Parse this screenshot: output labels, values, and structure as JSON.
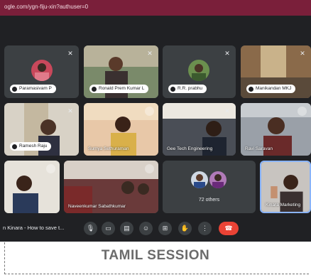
{
  "browser": {
    "url": "ogle.com/ygn-fiju-xin?authuser=0"
  },
  "participants": [
    {
      "name": "Paramasivam P"
    },
    {
      "name": "Ronald Prem Kumar L"
    },
    {
      "name": "R.R. prabhu"
    },
    {
      "name": "Manikandan MKJ"
    },
    {
      "name": "Ramesh Raju"
    },
    {
      "name": "Sumya Sethuraman"
    },
    {
      "name": "Gee Tech Engineering"
    },
    {
      "name": "Ravi Saravan"
    },
    {
      "name": ""
    },
    {
      "name": "Naveenkumar Sabathkumar"
    },
    {
      "name": "Kinara Marketing"
    }
  ],
  "others_count": "72 others",
  "meeting": {
    "title": "n Kinara - How to save t..."
  },
  "controls": [
    {
      "icon": "mic-icon"
    },
    {
      "icon": "camera-icon"
    },
    {
      "icon": "captions-icon"
    },
    {
      "icon": "emoji-icon"
    },
    {
      "icon": "present-icon"
    },
    {
      "icon": "raise-hand-icon"
    },
    {
      "icon": "more-options-icon"
    },
    {
      "icon": "end-call-icon"
    }
  ],
  "caption": "TAMIL SESSION",
  "colors": {
    "accent": "#7a1f3a",
    "stage": "#202124",
    "tile": "#3c4043",
    "end_call": "#ea4335"
  }
}
